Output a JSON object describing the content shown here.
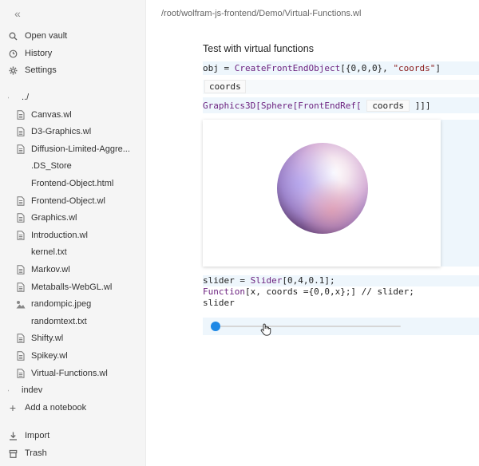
{
  "path": "/root/wolfram-js-frontend/Demo/Virtual-Functions.wl",
  "sidebar": {
    "nav": [
      {
        "label": "Open vault",
        "icon": "search-icon"
      },
      {
        "label": "History",
        "icon": "clock-icon"
      },
      {
        "label": "Settings",
        "icon": "gear-icon"
      }
    ],
    "files": [
      {
        "label": "../",
        "icon": "chevron-right-icon"
      },
      {
        "label": "Canvas.wl",
        "icon": "file-icon"
      },
      {
        "label": "D3-Graphics.wl",
        "icon": "file-icon"
      },
      {
        "label": "Diffusion-Limited-Aggre...",
        "icon": "file-icon"
      },
      {
        "label": ".DS_Store",
        "icon": ""
      },
      {
        "label": "Frontend-Object.html",
        "icon": ""
      },
      {
        "label": "Frontend-Object.wl",
        "icon": "file-icon"
      },
      {
        "label": "Graphics.wl",
        "icon": "file-icon"
      },
      {
        "label": "Introduction.wl",
        "icon": "file-icon"
      },
      {
        "label": "kernel.txt",
        "icon": ""
      },
      {
        "label": "Markov.wl",
        "icon": "file-icon"
      },
      {
        "label": "Metaballs-WebGL.wl",
        "icon": "file-icon"
      },
      {
        "label": "randompic.jpeg",
        "icon": "image-icon"
      },
      {
        "label": "randomtext.txt",
        "icon": ""
      },
      {
        "label": "Shifty.wl",
        "icon": "file-icon"
      },
      {
        "label": "Spikey.wl",
        "icon": "file-icon"
      },
      {
        "label": "Virtual-Functions.wl",
        "icon": "file-icon"
      },
      {
        "label": "indev",
        "icon": "chevron-right-icon"
      }
    ],
    "add_notebook": "Add a notebook",
    "import": "Import",
    "trash": "Trash"
  },
  "notebook": {
    "title": "Test with virtual functions",
    "cell1": {
      "obj": "obj",
      "eq": " = ",
      "fn": "CreateFrontEndObject",
      "args_open": "[{0,0,0}, ",
      "str": "\"coords\"",
      "args_close": "]"
    },
    "cell1_output": "coords",
    "cell2": {
      "fn": "Graphics3D[Sphere[FrontEndRef[",
      "box": "coords",
      "close": "]]]"
    },
    "cell3": {
      "line1_a": "slider = ",
      "line1_fn": "Slider",
      "line1_b": "[0,4,0.1];",
      "line2_fn": "Function",
      "line2_a": "[x,  coords  ={0,0,x};] // slider;",
      "line3": "slider"
    },
    "slider": {
      "min": 0,
      "max": 4,
      "step": 0.1,
      "value": 0
    }
  }
}
